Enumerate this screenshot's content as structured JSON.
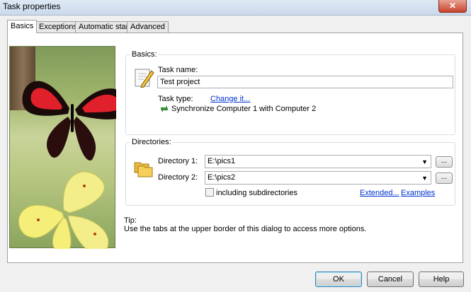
{
  "window": {
    "title": "Task properties",
    "close_label": "✕"
  },
  "tabs": [
    {
      "label": "Basics"
    },
    {
      "label": "Exceptions"
    },
    {
      "label": "Automatic start"
    },
    {
      "label": "Advanced"
    }
  ],
  "basics": {
    "group_label": "Basics:",
    "task_name_label": "Task name:",
    "task_name_value": "Test project",
    "task_type_label": "Task type:",
    "change_link": "Change it...",
    "task_type_value": "Synchronize Computer 1 with Computer 2"
  },
  "directories": {
    "group_label": "Directories:",
    "dir1_label": "Directory 1:",
    "dir1_value": "E:\\pics1",
    "dir2_label": "Directory 2:",
    "dir2_value": "E:\\pics2",
    "browse_label": "...",
    "subdirs_label": "including subdirectories",
    "extended_link": "Extended...",
    "examples_link": "Examples"
  },
  "tip": {
    "title": "Tip:",
    "text": "Use the tabs at the upper border of this dialog to access more options."
  },
  "buttons": {
    "ok": "OK",
    "cancel": "Cancel",
    "help": "Help"
  },
  "colors": {
    "link": "#0033cc",
    "accent": "#3c7fb1"
  }
}
